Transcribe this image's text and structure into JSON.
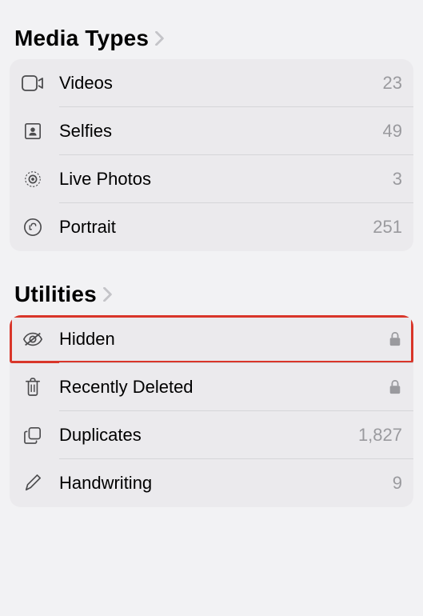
{
  "sections": {
    "mediaTypes": {
      "title": "Media Types",
      "items": [
        {
          "label": "Videos",
          "count": "23"
        },
        {
          "label": "Selfies",
          "count": "49"
        },
        {
          "label": "Live Photos",
          "count": "3"
        },
        {
          "label": "Portrait",
          "count": "251"
        }
      ]
    },
    "utilities": {
      "title": "Utilities",
      "items": [
        {
          "label": "Hidden",
          "locked": true
        },
        {
          "label": "Recently Deleted",
          "locked": true
        },
        {
          "label": "Duplicates",
          "count": "1,827"
        },
        {
          "label": "Handwriting",
          "count": "9"
        }
      ]
    }
  }
}
